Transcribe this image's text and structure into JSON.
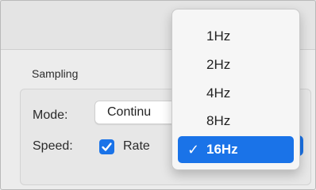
{
  "section": {
    "title": "Sampling"
  },
  "mode": {
    "label": "Mode:",
    "value": "Continu"
  },
  "speed": {
    "label": "Speed:",
    "checkbox_label": "Rate",
    "checked": true
  },
  "menu": {
    "items": [
      {
        "label": "1Hz",
        "selected": false
      },
      {
        "label": "2Hz",
        "selected": false
      },
      {
        "label": "4Hz",
        "selected": false
      },
      {
        "label": "8Hz",
        "selected": false
      },
      {
        "label": "16Hz",
        "selected": true
      }
    ],
    "check_glyph": "✓"
  },
  "colors": {
    "accent": "#1a73e8",
    "window": "#ececec"
  }
}
